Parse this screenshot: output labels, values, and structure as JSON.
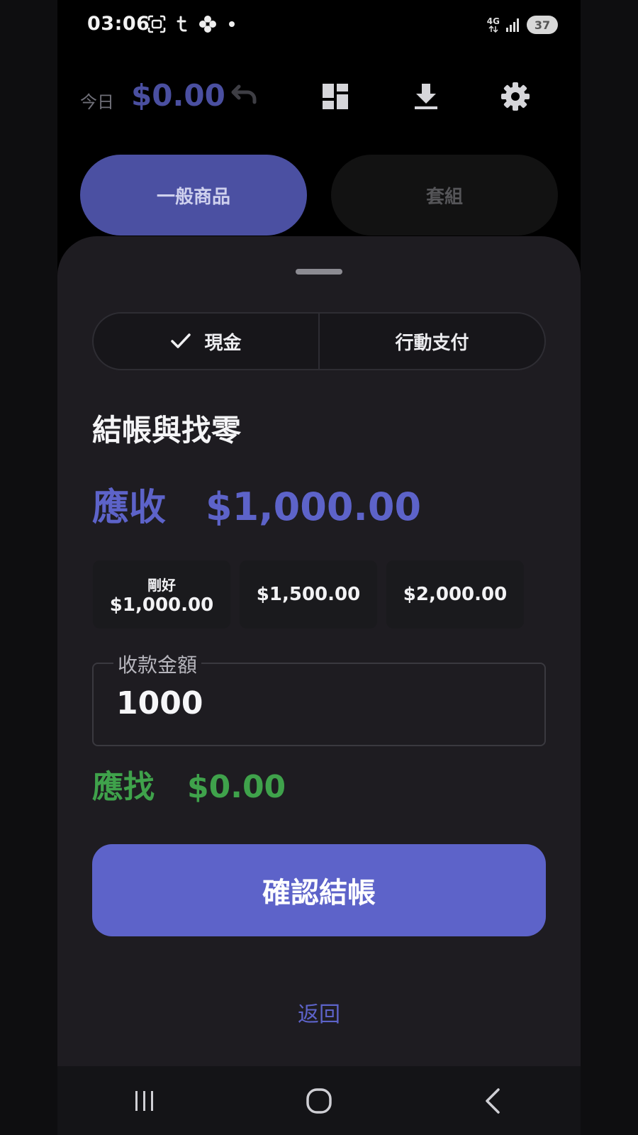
{
  "status_bar": {
    "time": "03:06",
    "left_icons": [
      "screen-capture-icon",
      "t-notification-icon",
      "pinwheel-icon",
      "dot-icon"
    ],
    "network": "4G",
    "battery": "37"
  },
  "header": {
    "today_label": "今日",
    "today_amount": "$0.00",
    "icons": [
      "undo-icon",
      "dashboard-icon",
      "download-icon",
      "settings-icon"
    ]
  },
  "tabs": [
    {
      "label": "一般商品",
      "active": true
    },
    {
      "label": "套組",
      "active": false
    }
  ],
  "payment_methods": [
    {
      "label": "現金",
      "selected": true
    },
    {
      "label": "行動支付",
      "selected": false
    }
  ],
  "checkout": {
    "title": "結帳與找零",
    "due_label": "應收",
    "due_amount": "$1,000.00",
    "quick_amounts": [
      {
        "caption": "剛好",
        "amount": "$1,000.00"
      },
      {
        "caption": "",
        "amount": "$1,500.00"
      },
      {
        "caption": "",
        "amount": "$2,000.00"
      }
    ],
    "received_label": "收款金額",
    "received_value": "1000",
    "change_label": "應找",
    "change_amount": "$0.00",
    "confirm_label": "確認結帳",
    "back_label": "返回"
  },
  "nav": [
    "recent-apps-icon",
    "home-icon",
    "back-icon"
  ],
  "colors": {
    "accent": "#5d63c9",
    "accent_dim": "#4b50a2",
    "success": "#3fa24b",
    "sheet_bg": "#1e1c21"
  }
}
